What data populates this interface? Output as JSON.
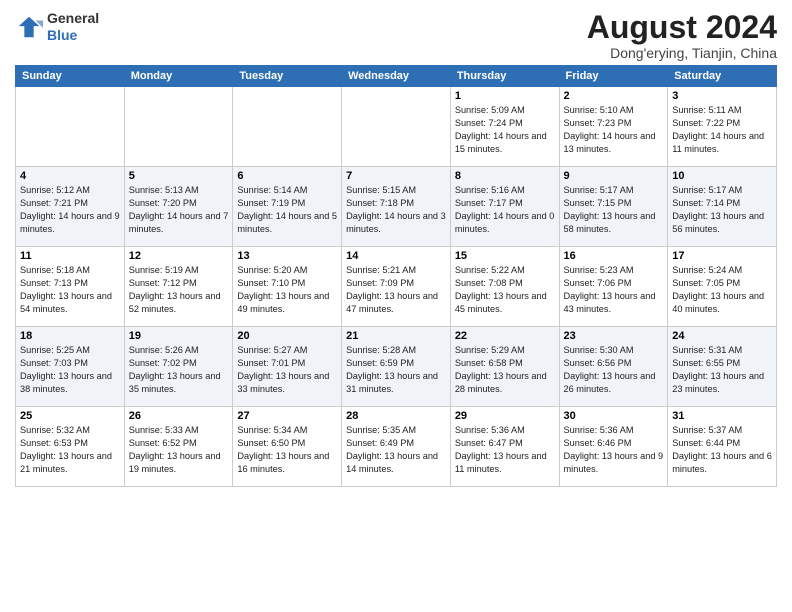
{
  "header": {
    "logo_line1": "General",
    "logo_line2": "Blue",
    "title": "August 2024",
    "subtitle": "Dong'erying, Tianjin, China"
  },
  "calendar": {
    "days_of_week": [
      "Sunday",
      "Monday",
      "Tuesday",
      "Wednesday",
      "Thursday",
      "Friday",
      "Saturday"
    ],
    "weeks": [
      [
        {
          "day": "",
          "info": ""
        },
        {
          "day": "",
          "info": ""
        },
        {
          "day": "",
          "info": ""
        },
        {
          "day": "",
          "info": ""
        },
        {
          "day": "1",
          "info": "Sunrise: 5:09 AM\nSunset: 7:24 PM\nDaylight: 14 hours\nand 15 minutes."
        },
        {
          "day": "2",
          "info": "Sunrise: 5:10 AM\nSunset: 7:23 PM\nDaylight: 14 hours\nand 13 minutes."
        },
        {
          "day": "3",
          "info": "Sunrise: 5:11 AM\nSunset: 7:22 PM\nDaylight: 14 hours\nand 11 minutes."
        }
      ],
      [
        {
          "day": "4",
          "info": "Sunrise: 5:12 AM\nSunset: 7:21 PM\nDaylight: 14 hours\nand 9 minutes."
        },
        {
          "day": "5",
          "info": "Sunrise: 5:13 AM\nSunset: 7:20 PM\nDaylight: 14 hours\nand 7 minutes."
        },
        {
          "day": "6",
          "info": "Sunrise: 5:14 AM\nSunset: 7:19 PM\nDaylight: 14 hours\nand 5 minutes."
        },
        {
          "day": "7",
          "info": "Sunrise: 5:15 AM\nSunset: 7:18 PM\nDaylight: 14 hours\nand 3 minutes."
        },
        {
          "day": "8",
          "info": "Sunrise: 5:16 AM\nSunset: 7:17 PM\nDaylight: 14 hours\nand 0 minutes."
        },
        {
          "day": "9",
          "info": "Sunrise: 5:17 AM\nSunset: 7:15 PM\nDaylight: 13 hours\nand 58 minutes."
        },
        {
          "day": "10",
          "info": "Sunrise: 5:17 AM\nSunset: 7:14 PM\nDaylight: 13 hours\nand 56 minutes."
        }
      ],
      [
        {
          "day": "11",
          "info": "Sunrise: 5:18 AM\nSunset: 7:13 PM\nDaylight: 13 hours\nand 54 minutes."
        },
        {
          "day": "12",
          "info": "Sunrise: 5:19 AM\nSunset: 7:12 PM\nDaylight: 13 hours\nand 52 minutes."
        },
        {
          "day": "13",
          "info": "Sunrise: 5:20 AM\nSunset: 7:10 PM\nDaylight: 13 hours\nand 49 minutes."
        },
        {
          "day": "14",
          "info": "Sunrise: 5:21 AM\nSunset: 7:09 PM\nDaylight: 13 hours\nand 47 minutes."
        },
        {
          "day": "15",
          "info": "Sunrise: 5:22 AM\nSunset: 7:08 PM\nDaylight: 13 hours\nand 45 minutes."
        },
        {
          "day": "16",
          "info": "Sunrise: 5:23 AM\nSunset: 7:06 PM\nDaylight: 13 hours\nand 43 minutes."
        },
        {
          "day": "17",
          "info": "Sunrise: 5:24 AM\nSunset: 7:05 PM\nDaylight: 13 hours\nand 40 minutes."
        }
      ],
      [
        {
          "day": "18",
          "info": "Sunrise: 5:25 AM\nSunset: 7:03 PM\nDaylight: 13 hours\nand 38 minutes."
        },
        {
          "day": "19",
          "info": "Sunrise: 5:26 AM\nSunset: 7:02 PM\nDaylight: 13 hours\nand 35 minutes."
        },
        {
          "day": "20",
          "info": "Sunrise: 5:27 AM\nSunset: 7:01 PM\nDaylight: 13 hours\nand 33 minutes."
        },
        {
          "day": "21",
          "info": "Sunrise: 5:28 AM\nSunset: 6:59 PM\nDaylight: 13 hours\nand 31 minutes."
        },
        {
          "day": "22",
          "info": "Sunrise: 5:29 AM\nSunset: 6:58 PM\nDaylight: 13 hours\nand 28 minutes."
        },
        {
          "day": "23",
          "info": "Sunrise: 5:30 AM\nSunset: 6:56 PM\nDaylight: 13 hours\nand 26 minutes."
        },
        {
          "day": "24",
          "info": "Sunrise: 5:31 AM\nSunset: 6:55 PM\nDaylight: 13 hours\nand 23 minutes."
        }
      ],
      [
        {
          "day": "25",
          "info": "Sunrise: 5:32 AM\nSunset: 6:53 PM\nDaylight: 13 hours\nand 21 minutes."
        },
        {
          "day": "26",
          "info": "Sunrise: 5:33 AM\nSunset: 6:52 PM\nDaylight: 13 hours\nand 19 minutes."
        },
        {
          "day": "27",
          "info": "Sunrise: 5:34 AM\nSunset: 6:50 PM\nDaylight: 13 hours\nand 16 minutes."
        },
        {
          "day": "28",
          "info": "Sunrise: 5:35 AM\nSunset: 6:49 PM\nDaylight: 13 hours\nand 14 minutes."
        },
        {
          "day": "29",
          "info": "Sunrise: 5:36 AM\nSunset: 6:47 PM\nDaylight: 13 hours\nand 11 minutes."
        },
        {
          "day": "30",
          "info": "Sunrise: 5:36 AM\nSunset: 6:46 PM\nDaylight: 13 hours\nand 9 minutes."
        },
        {
          "day": "31",
          "info": "Sunrise: 5:37 AM\nSunset: 6:44 PM\nDaylight: 13 hours\nand 6 minutes."
        }
      ]
    ]
  }
}
